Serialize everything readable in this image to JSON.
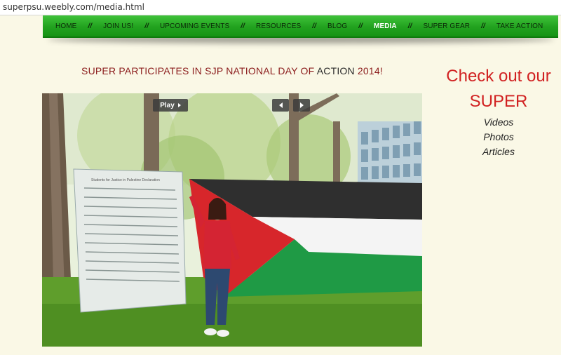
{
  "browser": {
    "url": "superpsu.weebly.com/media.html"
  },
  "nav": {
    "items": [
      {
        "label": "HOME"
      },
      {
        "label": "JOIN US!"
      },
      {
        "label": "UPCOMING EVENTS"
      },
      {
        "label": "RESOURCES"
      },
      {
        "label": "BLOG"
      },
      {
        "label": "MEDIA",
        "active": true
      },
      {
        "label": "SUPER GEAR"
      },
      {
        "label": "TAKE ACTION"
      }
    ],
    "separator": "//"
  },
  "headline": {
    "part1": "SUPER PARTICIPATES IN SJP NATIONAL DAY OF ",
    "part2": "ACTION",
    "part3": " 2014!"
  },
  "slideshow": {
    "play_label": "Play",
    "prev_icon": "chevron-left-icon",
    "next_icon": "chevron-right-icon"
  },
  "sidebar": {
    "title_line1": "Check out our",
    "title_line2": "SUPER",
    "links": [
      "Videos",
      "Photos",
      "Articles"
    ]
  },
  "colors": {
    "nav_green": "#22a21f",
    "headline_red": "#8b1c1c",
    "sidebar_red": "#d12222",
    "background": "#faf8e6"
  }
}
